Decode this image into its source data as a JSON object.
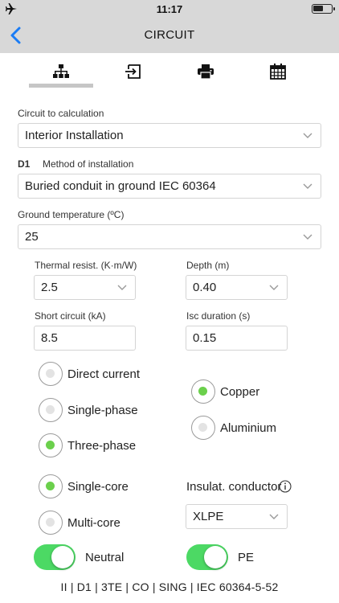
{
  "status_bar": {
    "time": "11:17",
    "icons": [
      "airplane-icon",
      "battery-icon"
    ],
    "battery_level": 0.55
  },
  "nav": {
    "title": "CIRCUIT",
    "back_icon": "chevron-left-icon",
    "accent": "#1a7cf5"
  },
  "tabs": [
    {
      "name": "tree",
      "icon": "hierarchy-icon",
      "selected": true
    },
    {
      "name": "export",
      "icon": "export-icon",
      "selected": false
    },
    {
      "name": "print",
      "icon": "printer-icon",
      "selected": false
    },
    {
      "name": "calendar",
      "icon": "calendar-icon",
      "selected": false
    }
  ],
  "form": {
    "circuit_label": "Circuit to calculation",
    "circuit_value": "Interior Installation",
    "method_code": "D1",
    "method_label": "Method of installation",
    "method_value": "Buried conduit in ground IEC 60364",
    "ground_temp_label": "Ground temperature (ºC)",
    "ground_temp_value": "25",
    "thermal_label": "Thermal resist. (K·m/W)",
    "thermal_value": "2.5",
    "depth_label": "Depth (m)",
    "depth_value": "0.40",
    "short_circuit_label": "Short circuit (kA)",
    "short_circuit_value": "8.5",
    "isc_label": "Isc duration (s)",
    "isc_value": "0.15",
    "insulat_label": "Insulat. conductor",
    "insulat_info_icon": "info-icon",
    "insulat_value": "XLPE"
  },
  "current_type": [
    {
      "label": "Direct current",
      "selected": false
    },
    {
      "label": "Single-phase",
      "selected": false
    },
    {
      "label": "Three-phase",
      "selected": true
    }
  ],
  "material": [
    {
      "label": "Copper",
      "selected": true
    },
    {
      "label": "Aluminium",
      "selected": false
    }
  ],
  "core": [
    {
      "label": "Single-core",
      "selected": true
    },
    {
      "label": "Multi-core",
      "selected": false
    }
  ],
  "toggles": {
    "neutral_label": "Neutral",
    "neutral_on": true,
    "pe_label": "PE",
    "pe_on": true
  },
  "footer": {
    "summary": "II | D1 | 3TE | CO | SING | IEC 60364-5-52"
  },
  "colors": {
    "radio_on": "#6bd04c",
    "toggle_on": "#4cd964",
    "bar_bg": "#d8d8d8"
  }
}
